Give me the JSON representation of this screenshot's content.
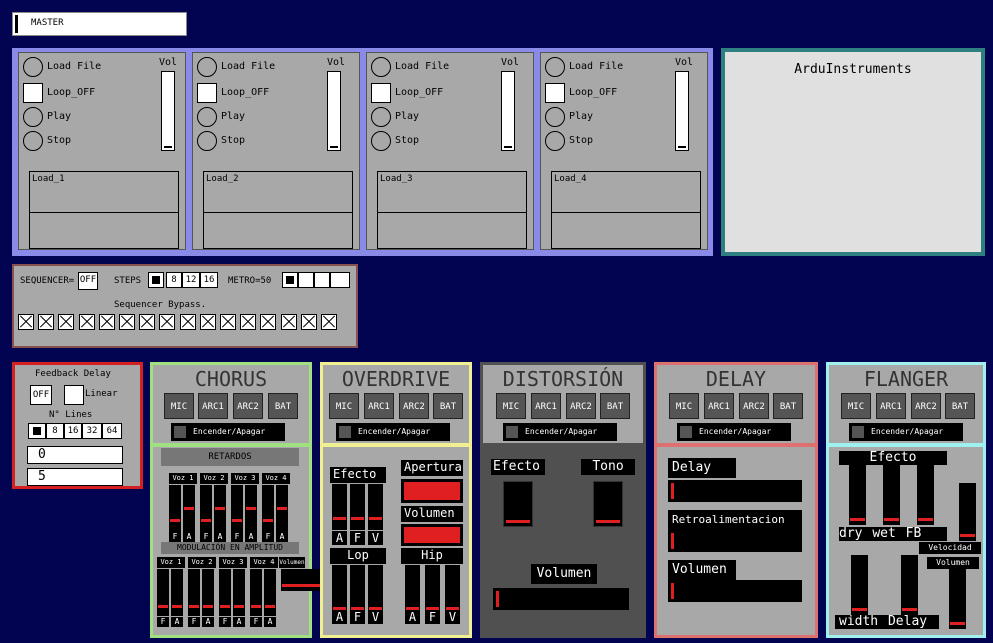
{
  "master": {
    "label": "MASTER"
  },
  "tracks": [
    {
      "load_label": "Load File",
      "loop_label": "Loop_OFF",
      "play_label": "Play",
      "stop_label": "Stop",
      "vol_label": "Vol",
      "slot": "Load_1"
    },
    {
      "load_label": "Load File",
      "loop_label": "Loop_OFF",
      "play_label": "Play",
      "stop_label": "Stop",
      "vol_label": "Vol",
      "slot": "Load_2"
    },
    {
      "load_label": "Load File",
      "loop_label": "Loop_OFF",
      "play_label": "Play",
      "stop_label": "Stop",
      "vol_label": "Vol",
      "slot": "Load_3"
    },
    {
      "load_label": "Load File",
      "loop_label": "Loop_OFF",
      "play_label": "Play",
      "stop_label": "Stop",
      "vol_label": "Vol",
      "slot": "Load_4"
    }
  ],
  "ardu": {
    "title": "ArduInstruments"
  },
  "sequencer": {
    "label": "SEQUENCER=",
    "state": "OFF",
    "steps_label": "STEPS",
    "steps": [
      "8",
      "12",
      "16"
    ],
    "metro_label": "METRO=50",
    "bypass_label": "Sequencer Bypass."
  },
  "feedback": {
    "title": "Feedback Delay",
    "off": "OFF",
    "linear": "Linear",
    "lines_label": "N° Lines",
    "lines": [
      "8",
      "16",
      "32",
      "64"
    ],
    "num1": "0",
    "num2": "5"
  },
  "common": {
    "mic": "MIC",
    "arc1": "ARC1",
    "arc2": "ARC2",
    "bat": "BAT",
    "onoff": "Encender/Apagar",
    "f": "F",
    "a": "A",
    "v": "V"
  },
  "chorus": {
    "title": "CHORUS",
    "retardos": "RETARDOS",
    "modulacion": "MODULACIÓN EN AMPLITUD",
    "voices": [
      "Voz 1",
      "Voz 2",
      "Voz 3",
      "Voz 4"
    ],
    "volumen": "Volumen"
  },
  "overdrive": {
    "title": "OVERDRIVE",
    "efecto": "Efecto",
    "apertura": "Apertura",
    "volumen": "Volumen",
    "lop": "Lop",
    "hip": "Hip"
  },
  "distorsion": {
    "title": "DISTORSIÓN",
    "efecto": "Efecto",
    "tono": "Tono",
    "volumen": "Volumen"
  },
  "delay": {
    "title": "DELAY",
    "delay": "Delay",
    "retro": "Retroalimentacion",
    "volumen": "Volumen"
  },
  "flanger": {
    "title": "FLANGER",
    "efecto": "Efecto",
    "dry": "dry",
    "wet": "wet",
    "fb": "FB",
    "velocidad": "Velocidad",
    "volumen": "Volumen",
    "width": "width",
    "delay": "Delay"
  },
  "colors": {
    "bg": "#020452",
    "tracks": "#8a8ae8",
    "ardu": "#2e8080",
    "chorus": "#a0e080",
    "overdrive": "#f0f090",
    "distorsion": "#505050",
    "delay": "#e07070",
    "flanger": "#a0f0f0",
    "feedback": "#d42020"
  }
}
